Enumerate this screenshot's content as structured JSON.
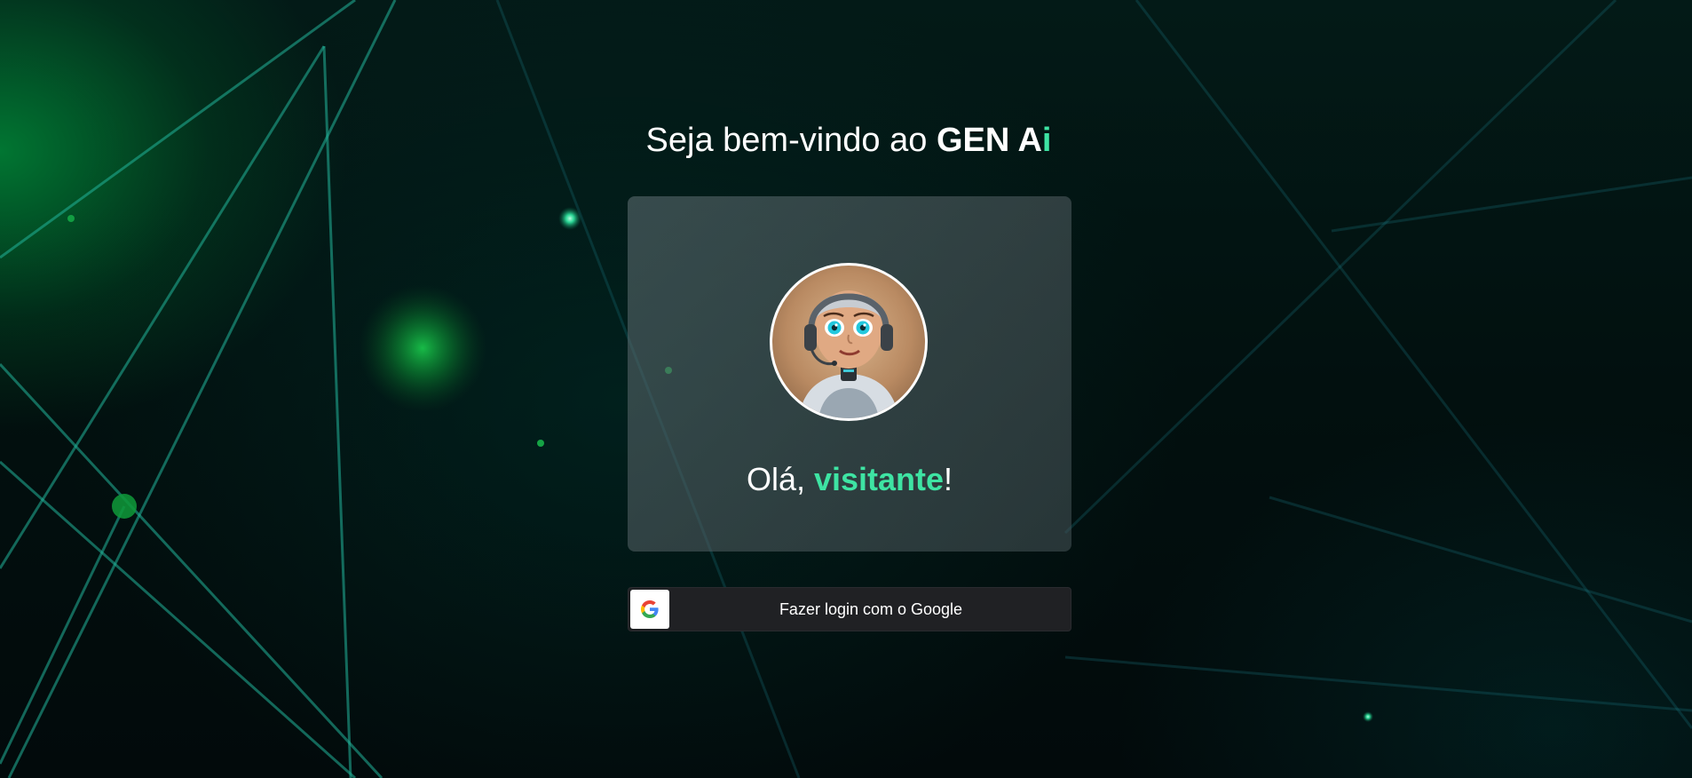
{
  "header": {
    "title_prefix": "Seja bem-vindo ao ",
    "brand_main": "GEN A",
    "brand_accent": "i"
  },
  "card": {
    "avatar_icon": "robot-assistant-avatar",
    "greeting_prefix": "Olá, ",
    "greeting_name": "visitante",
    "greeting_suffix": "!"
  },
  "login": {
    "google_button_label": "Fazer login com o Google",
    "google_icon": "google-g-icon"
  },
  "colors": {
    "accent": "#3ee4a3",
    "background": "#020d0e",
    "card": "#4f5c60",
    "button": "#202124"
  }
}
